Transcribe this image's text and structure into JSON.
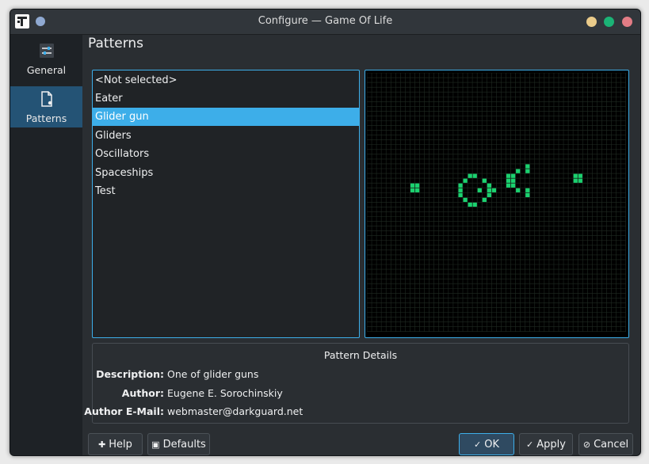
{
  "window": {
    "title": "Configure — Game Of Life"
  },
  "sidebar": {
    "items": [
      {
        "label": "General",
        "icon": "sliders-icon"
      },
      {
        "label": "Patterns",
        "icon": "document-icon"
      }
    ],
    "active": "Patterns"
  },
  "page": {
    "title": "Patterns"
  },
  "patterns": {
    "items": [
      "<Not selected>",
      "Eater",
      "Glider gun",
      "Gliders",
      "Oscillators",
      "Spaceships",
      "Test"
    ],
    "selected": "Glider gun"
  },
  "details": {
    "title": "Pattern Details",
    "description_label": "Description:",
    "description": "One of glider guns",
    "author_label": "Author:",
    "author": "Eugene E. Sorochinskiy",
    "email_label": "Author E-Mail:",
    "email": "webmaster@darkguard.net"
  },
  "buttons": {
    "help": "Help",
    "defaults": "Defaults",
    "ok": "OK",
    "apply": "Apply",
    "cancel": "Cancel"
  },
  "colors": {
    "accent": "#3daee9",
    "live_cell": "#1bd16f",
    "grid_background": "#000000"
  }
}
